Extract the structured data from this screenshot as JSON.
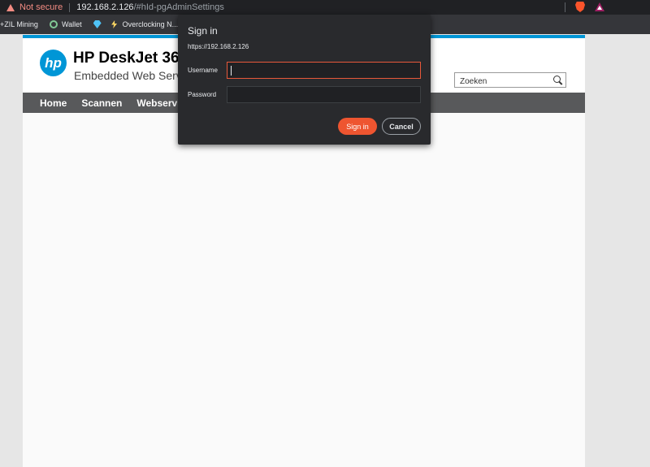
{
  "browser": {
    "security_label": "Not secure",
    "url_host": "192.168.2.126",
    "url_path": "/#hId-pgAdminSettings"
  },
  "bookmarks": [
    {
      "label": "+ZIL Mining",
      "icon": "none"
    },
    {
      "label": "Wallet",
      "icon": "wallet-icon"
    },
    {
      "label": "",
      "icon": "diamond-icon"
    },
    {
      "label": "Overclocking N...",
      "icon": "bolt-icon"
    }
  ],
  "page": {
    "logo_text": "hp",
    "product_name": "HP DeskJet 36",
    "product_subtitle": "Embedded Web Server",
    "search_placeholder": "Zoeken",
    "nav": [
      {
        "label": "Home"
      },
      {
        "label": "Scannen"
      },
      {
        "label": "Webservic"
      }
    ]
  },
  "dialog": {
    "title": "Sign in",
    "origin": "https://192.168.2.126",
    "username_label": "Username",
    "username_value": "",
    "password_label": "Password",
    "password_value": "",
    "signin_label": "Sign in",
    "cancel_label": "Cancel"
  },
  "colors": {
    "accent": "#0096d6",
    "warning": "#f28b82",
    "primary_button": "#ee5530"
  }
}
